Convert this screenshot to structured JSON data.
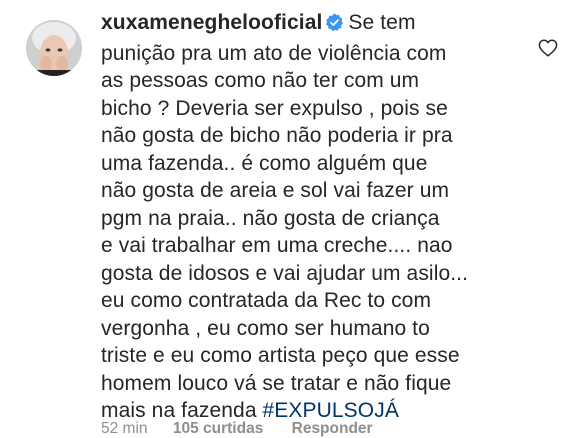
{
  "comment": {
    "username": "xuxameneghelooficial",
    "verified": true,
    "lines": [
      "Se tem",
      "punição pra um ato de violência com",
      "as pessoas como não ter com um",
      "bicho ? Deveria ser expulso , pois se",
      "não gosta de bicho não poderia ir pra",
      "uma fazenda.. é como alguém que",
      "não gosta de areia e sol vai fazer um",
      "pgm na praia.. não gosta de criança",
      "e vai trabalhar em uma creche.... nao",
      "gosta de idosos e vai ajudar um asilo...",
      "eu como contratada da Rec to com",
      "vergonha , eu como ser humano to",
      "triste e eu como artista  peço que esse",
      "homem louco vá se tratar e não fique",
      "mais na fazenda "
    ],
    "hashtag": "#EXPULSOJÁ",
    "time": "52 min",
    "likes": "105 curtidas",
    "reply_label": "Responder"
  },
  "icons": {
    "verified": "verified-badge-icon",
    "like": "heart-outline-icon"
  },
  "colors": {
    "text": "#262626",
    "hashtag": "#003569",
    "meta": "#8e8e8e",
    "verified_badge": "#3897f0"
  }
}
